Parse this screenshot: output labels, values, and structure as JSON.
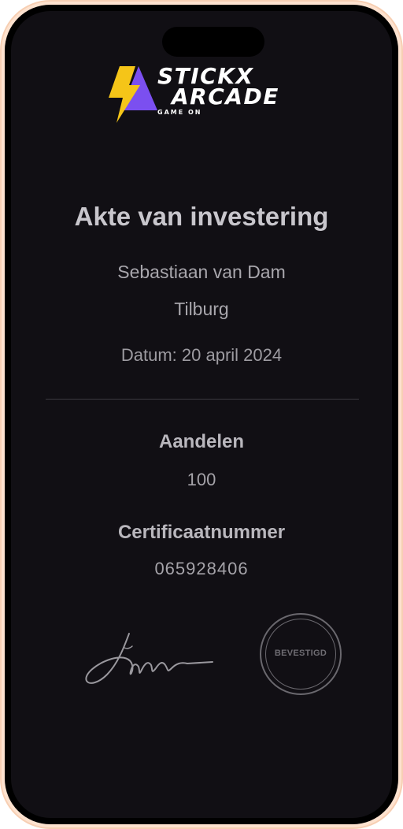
{
  "brand": {
    "line1": "STICKX",
    "line2": "ARCADE",
    "tagline": "GAME ON",
    "colors": {
      "bolt": "#f5c518",
      "triangle": "#7b4ff0"
    }
  },
  "certificate": {
    "title": "Akte van investering",
    "name": "Sebastiaan van Dam",
    "city": "Tilburg",
    "date": "Datum: 20 april 2024",
    "shares_label": "Aandelen",
    "shares_value": "100",
    "cert_label": "Certificaatnummer",
    "cert_value": "065928406"
  },
  "seal": {
    "text": "BEVESTIGD"
  }
}
